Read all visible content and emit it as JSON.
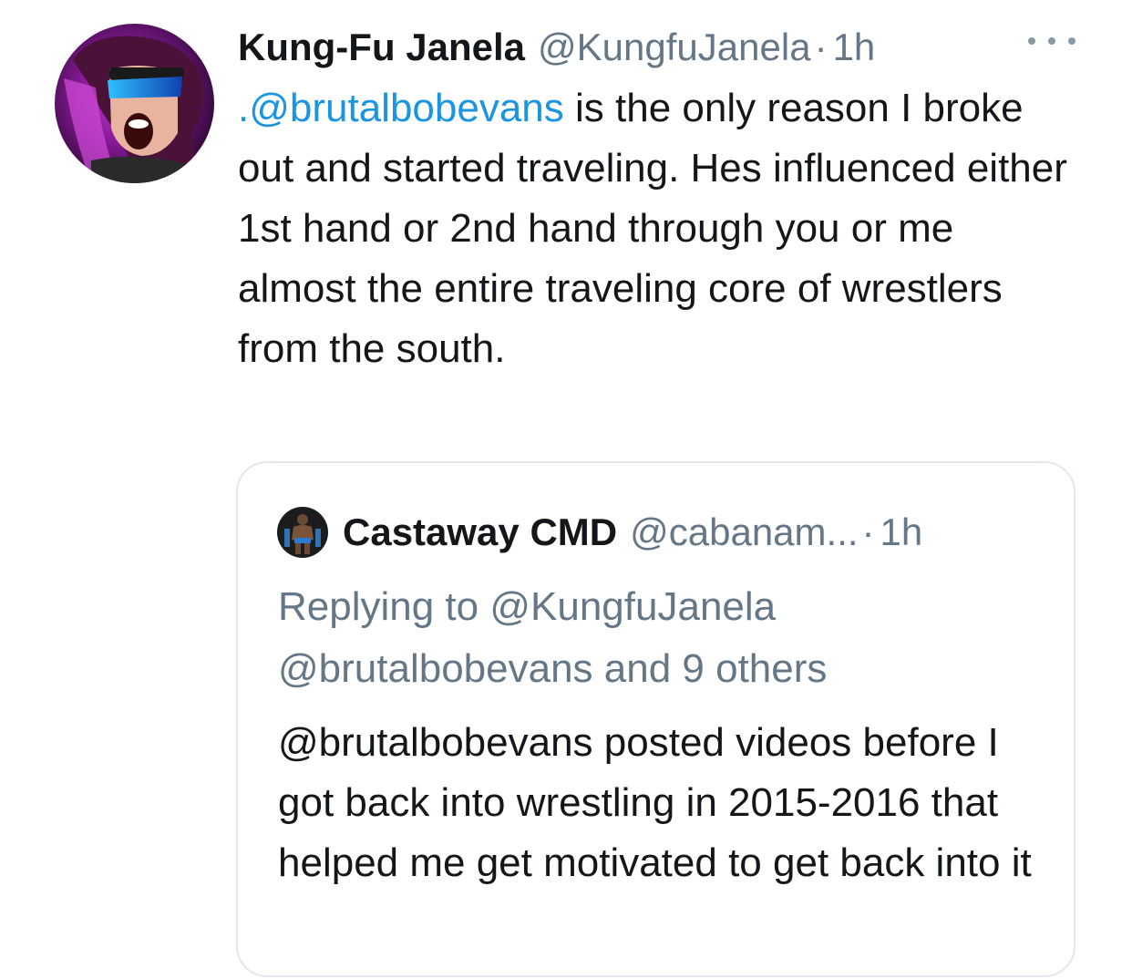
{
  "tweet": {
    "author_name": "Kung-Fu Janela",
    "author_handle": "@KungfuJanela",
    "separator": "·",
    "time": "1h",
    "mention": ".@brutalbobevans",
    "text_rest": " is the only reason I broke out and started traveling. Hes influenced either 1st hand or 2nd hand through you or me almost the entire traveling core of wrestlers from the south.",
    "avatar_icon": "profile-photo",
    "more_icon": "more-horizontal-icon"
  },
  "quote": {
    "author_name": "Castaway CMD",
    "author_handle": "@cabanam...",
    "separator": "·",
    "time": "1h",
    "replying_line1": "Replying to @KungfuJanela",
    "replying_line2": "@brutalbobevans and 9 others",
    "text": "@brutalbobevans posted videos before I got back into wrestling in 2015-2016 that helped me get motivated to get back into it"
  },
  "colors": {
    "text": "#14171a",
    "secondary": "#657786",
    "link": "#1b95e0",
    "border": "#e1e8ed"
  }
}
